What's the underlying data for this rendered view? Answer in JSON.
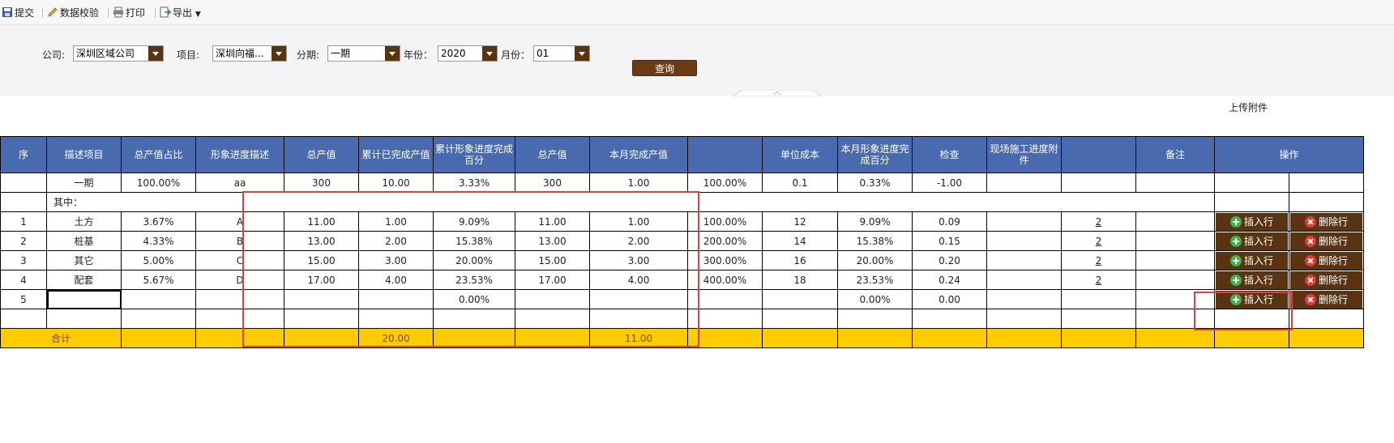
{
  "toolbar": {
    "submit": "提交",
    "validate": "数据校验",
    "print": "打印",
    "export": "导出"
  },
  "filters": {
    "company_label": "公司:",
    "company_value": "深圳区域公司",
    "project_label": "项目:",
    "project_value": "深圳向福...",
    "phase_label": "分期:",
    "phase_value": "一期",
    "year_label": "年份：",
    "year_value": "2020",
    "month_label": "月份：",
    "month_value": "01",
    "query_button": "查询"
  },
  "upload_attachment": "上传附件",
  "table": {
    "headers": [
      "序",
      "描述项目",
      "总产值占比",
      "形象进度描述",
      "总产值",
      "累计已完成产值",
      "累计形象进度完成百分",
      "总产值",
      "本月完成产值",
      "",
      "单位成本",
      "本月形象进度完成百分",
      "检查",
      "现场施工进度附件",
      "",
      "备注",
      "操作"
    ],
    "summary_row": {
      "seq": "",
      "item": "一期",
      "ratio": "100.00%",
      "desc": "aa",
      "total": "300",
      "cum_done": "10.00",
      "cum_pct": "3.33%",
      "total2": "300",
      "month_done": "1.00",
      "pct_col": "100.00%",
      "unit_cost": "0.1",
      "month_pct": "0.33%",
      "check": "-1.00"
    },
    "subheader": "其中：",
    "rows": [
      {
        "seq": "1",
        "item": "土方",
        "ratio": "3.67%",
        "desc": "A",
        "total": "11.00",
        "cum_done": "1.00",
        "cum_pct": "9.09%",
        "total2": "11.00",
        "month_done": "1.00",
        "pct_col": "100.00%",
        "unit_cost": "12",
        "month_pct": "9.09%",
        "check": "0.09",
        "attach": "2"
      },
      {
        "seq": "2",
        "item": "桩基",
        "ratio": "4.33%",
        "desc": "B",
        "total": "13.00",
        "cum_done": "2.00",
        "cum_pct": "15.38%",
        "total2": "13.00",
        "month_done": "2.00",
        "pct_col": "200.00%",
        "unit_cost": "14",
        "month_pct": "15.38%",
        "check": "0.15",
        "attach": "2"
      },
      {
        "seq": "3",
        "item": "其它",
        "ratio": "5.00%",
        "desc": "C",
        "total": "15.00",
        "cum_done": "3.00",
        "cum_pct": "20.00%",
        "total2": "15.00",
        "month_done": "3.00",
        "pct_col": "300.00%",
        "unit_cost": "16",
        "month_pct": "20.00%",
        "check": "0.20",
        "attach": "2"
      },
      {
        "seq": "4",
        "item": "配套",
        "ratio": "5.67%",
        "desc": "D",
        "total": "17.00",
        "cum_done": "4.00",
        "cum_pct": "23.53%",
        "total2": "17.00",
        "month_done": "4.00",
        "pct_col": "400.00%",
        "unit_cost": "18",
        "month_pct": "23.53%",
        "check": "0.24",
        "attach": "2"
      }
    ],
    "new_row": {
      "seq": "5",
      "cum_pct": "0.00%",
      "month_pct": "0.00%",
      "check": "0.00"
    },
    "insert_label": "插入行",
    "delete_label": "删除行",
    "total_row": {
      "label": "合计",
      "cum_done": "20.00",
      "month_done": "11.00"
    }
  },
  "colors": {
    "header_bg": "#4a6ab0",
    "total_bg": "#ffcc00",
    "button_bg": "#5a3410",
    "highlight": "#ec3b3b"
  }
}
